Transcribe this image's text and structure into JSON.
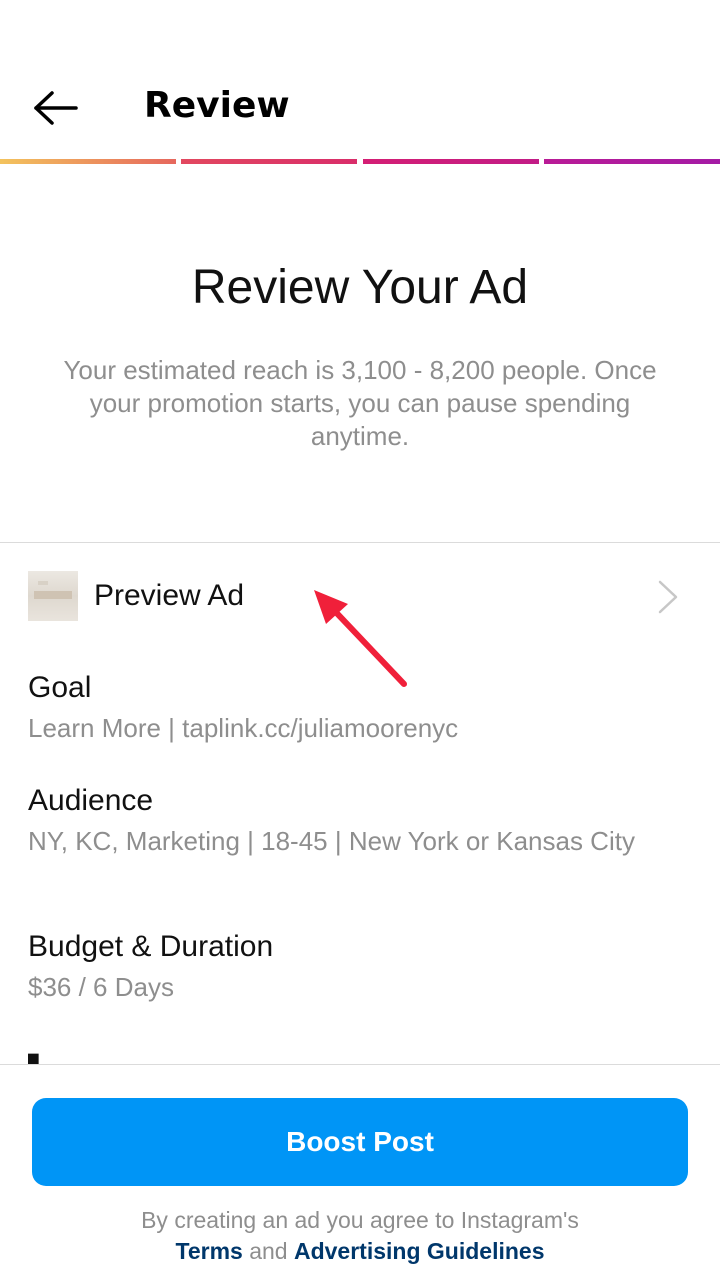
{
  "header": {
    "title": "Review"
  },
  "progress": {
    "steps_total": 4,
    "steps_complete": 4,
    "colors": [
      "#f0b659",
      "#e8455e",
      "#d11f78",
      "#a41ba5"
    ]
  },
  "intro": {
    "title": "Review Your Ad",
    "text": "Your estimated reach is 3,100 - 8,200 people. Once your promotion starts, you can pause spending anytime."
  },
  "preview": {
    "label": "Preview Ad"
  },
  "sections": {
    "goal": {
      "title": "Goal",
      "value": "Learn More | taplink.cc/juliamoorenyc"
    },
    "audience": {
      "title": "Audience",
      "value": "NY, KC, Marketing | 18-45 | New York or Kansas City"
    },
    "budget": {
      "title": "Budget & Duration",
      "value": "$36 / 6 Days"
    }
  },
  "footer": {
    "button_label": "Boost Post",
    "legal_prefix": "By creating an ad you agree to Instagram's",
    "terms_link": "Terms",
    "and_text": "and",
    "guidelines_link": "Advertising Guidelines"
  },
  "colors": {
    "accent": "#0095f6",
    "link": "#00376b",
    "secondary_text": "#8e8e8e",
    "annotation": "#f0203a"
  },
  "icons": {
    "back": "arrow-left-icon",
    "chevron": "chevron-right-icon",
    "annotation": "red-arrow-icon"
  }
}
